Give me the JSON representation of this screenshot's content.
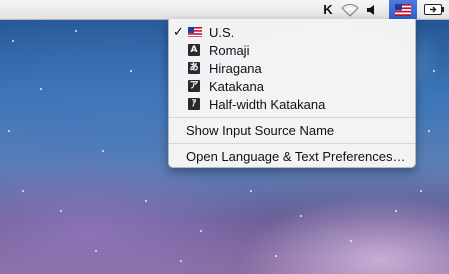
{
  "menubar": {
    "items": [
      {
        "name": "keyboard-maestro-icon"
      },
      {
        "name": "wifi-icon"
      },
      {
        "name": "volume-icon"
      },
      {
        "name": "input-source-flag-icon"
      },
      {
        "name": "battery-icon"
      }
    ]
  },
  "menu": {
    "input_sources": [
      {
        "label": "U.S.",
        "checked": true,
        "icon": "us-flag-icon"
      },
      {
        "label": "Romaji",
        "checked": false,
        "icon": "romaji-icon",
        "glyph": "A"
      },
      {
        "label": "Hiragana",
        "checked": false,
        "icon": "hiragana-icon",
        "glyph": "あ"
      },
      {
        "label": "Katakana",
        "checked": false,
        "icon": "katakana-icon",
        "glyph": "ア"
      },
      {
        "label": "Half-width Katakana",
        "checked": false,
        "icon": "half-width-katakana-icon",
        "glyph": "ｱ"
      }
    ],
    "check_mark": "✓",
    "show_input_source_name": "Show Input Source Name",
    "open_preferences": "Open Language & Text Preferences…"
  }
}
